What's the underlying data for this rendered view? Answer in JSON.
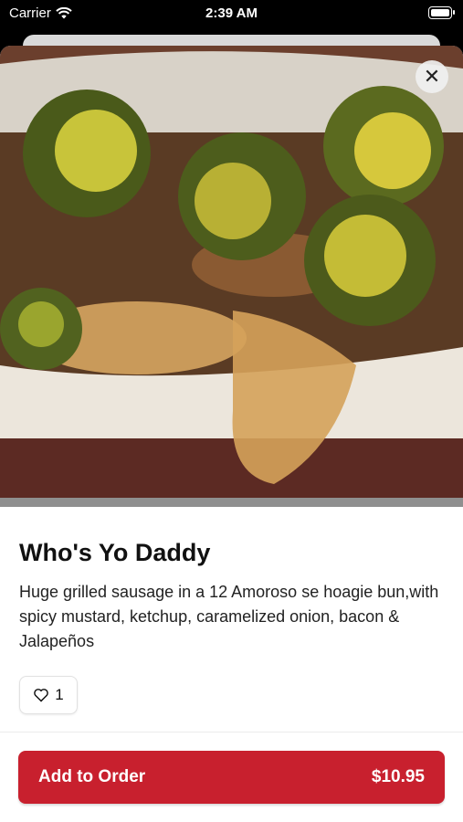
{
  "status_bar": {
    "carrier": "Carrier",
    "time": "2:39 AM"
  },
  "item": {
    "name": "Who's Yo Daddy",
    "description": "Huge grilled sausage in a 12 Amoroso se hoagie bun,with spicy mustard, ketchup, caramelized onion, bacon & Jalapeños",
    "like_count": "1",
    "image_alt": "Grilled sausage hoagie topped with jalapeños and caramelized onions"
  },
  "actions": {
    "add_label": "Add to Order",
    "price": "$10.95",
    "close_icon": "close-icon"
  },
  "colors": {
    "accent": "#c8202e",
    "sheet_bg": "#ffffff",
    "status_bg": "#000000"
  }
}
